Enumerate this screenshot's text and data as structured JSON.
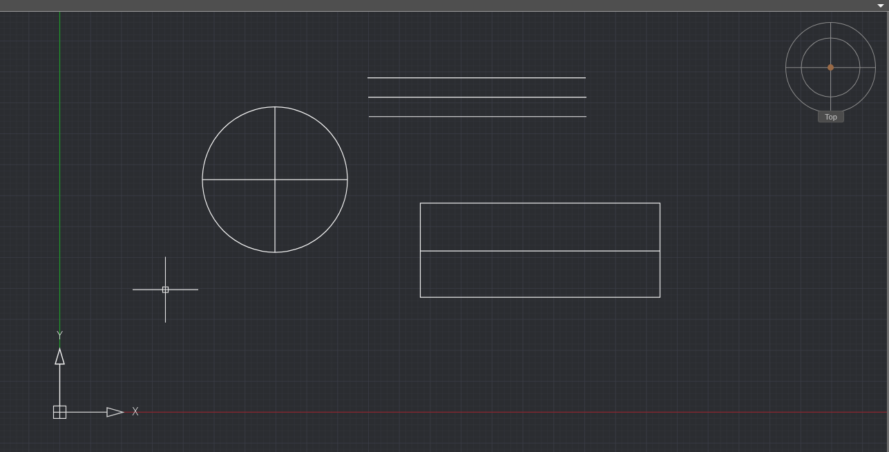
{
  "viewport": {
    "entities": [
      {
        "kind": "line"
      },
      {
        "kind": "line"
      },
      {
        "kind": "line"
      },
      {
        "kind": "circle"
      },
      {
        "kind": "rectangle"
      }
    ]
  },
  "navigation_wheel": {
    "view_label": "Top"
  },
  "ucs_icon": {
    "x_label": "X",
    "y_label": "Y"
  }
}
